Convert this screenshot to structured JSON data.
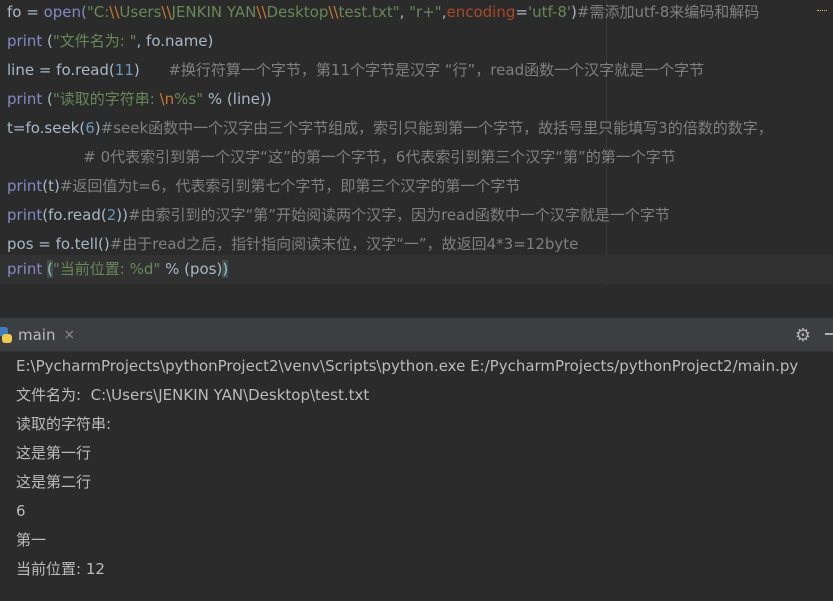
{
  "editor": {
    "line1": {
      "a": "fo = ",
      "b": "open(",
      "c": "\"C:",
      "d": "\\\\",
      "e": "Users",
      "f": "\\\\",
      "g": "JENKIN YAN",
      "h": "\\\\",
      "i": "Desktop",
      "j": "\\\\",
      "k": "test.txt\"",
      "l": ", ",
      "m": "\"r+\"",
      "n": ",",
      "o": "encoding",
      "p": "=",
      "q": "'utf-8'",
      "r": ")",
      "s": "#需添加utf-8来编码和解码"
    },
    "line2": {
      "a": "print",
      "b": " (",
      "c": "\"文件名为: \"",
      "d": ", fo.name)"
    },
    "line3": {
      "a": "line = fo.read(",
      "b": "11",
      "c": ")",
      "d": "      #换行符算一个字节，第11个字节是汉字 “行”，read函数一个汉字就是一个字节"
    },
    "line4": {
      "a": "print",
      "b": " (",
      "c": "\"读取的字符串: ",
      "d": "\\n",
      "e": "%s\"",
      "f": " % (line))"
    },
    "line5": {
      "a": "t=fo.seek(",
      "b": "6",
      "c": ")",
      "d": "#seek函数中一个汉字由三个字节组成，索引只能到第一个字节，故括号里只能填写3的倍数的数字，"
    },
    "line6": {
      "a": "                # 0代表索引到第一个汉字“这”的第一个字节，6代表索引到第三个汉字“第”的第一个字节"
    },
    "line7": {
      "a": "print",
      "b": "(t)",
      "c": "#返回值为t=6，代表索引到第七个字节，即第三个汉字的第一个字节"
    },
    "line8": {
      "a": "print",
      "b": "(fo.read(",
      "c": "2",
      "d": "))",
      "e": "#由索引到的汉字“第”开始阅读两个汉字，因为read函数中一个汉字就是一个字节"
    },
    "line9": {
      "a": "pos = fo.tell()",
      "b": "#由于read之后，指针指向阅读末位，汉字“一”，故返回4*3=12byte"
    },
    "line10": {
      "a": "print",
      "b": " ",
      "c": "(",
      "d": "\"当前位置: %d\"",
      "e": " % (pos)",
      "f": ")"
    }
  },
  "run_panel": {
    "tab_label": "main",
    "close_glyph": "×",
    "gear_glyph": "⚙"
  },
  "console": {
    "lines": [
      "E:\\PycharmProjects\\pythonProject2\\venv\\Scripts\\python.exe E:/PycharmProjects/pythonProject2/main.py",
      "文件名为:  C:\\Users\\JENKIN YAN\\Desktop\\test.txt",
      "读取的字符串:",
      "这是第一行",
      "这是第二行",
      "6",
      "第一",
      "当前位置: 12"
    ]
  }
}
